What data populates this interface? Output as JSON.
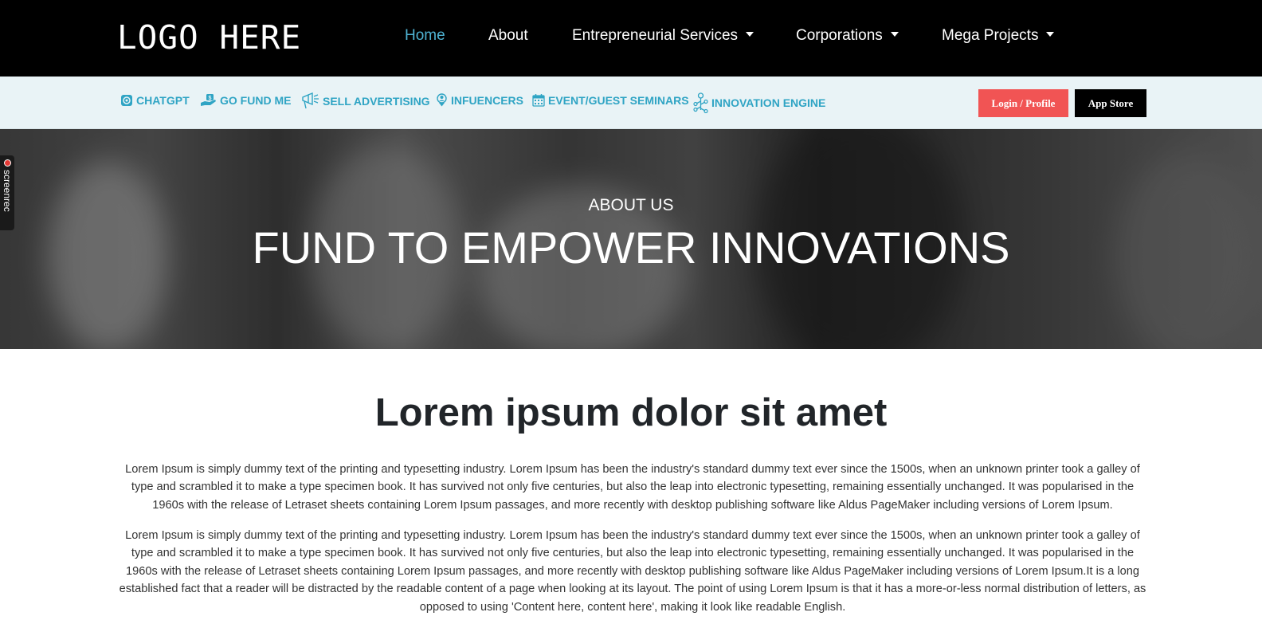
{
  "header": {
    "logo": "LOGO HERE",
    "nav": [
      {
        "label": "Home",
        "active": true
      },
      {
        "label": "About"
      },
      {
        "label": "Entrepreneurial Services"
      },
      {
        "label": "Corporations"
      },
      {
        "label": "Mega Projects"
      }
    ]
  },
  "subnav": {
    "items": [
      {
        "label": "CHATGPT",
        "icon": "chatgpt-icon"
      },
      {
        "label": "GO FUND ME",
        "icon": "money-hand-icon"
      },
      {
        "label": "SELL ADVERTISING",
        "icon": "advertising-icon"
      },
      {
        "label": "INFUENCERS",
        "icon": "influencer-icon"
      },
      {
        "label": "EVENT/GUEST SEMINARS",
        "icon": "calendar-icon"
      },
      {
        "label": "INNOVATION ENGINE",
        "icon": "innovation-icon"
      }
    ],
    "login_label": "Login / Profile",
    "app_store_label": "App Store"
  },
  "hero": {
    "eyebrow": "ABOUT US",
    "title": "FUND TO EMPOWER INNOVATIONS"
  },
  "screenrec": {
    "label": "screenrec"
  },
  "content": {
    "heading": "Lorem ipsum dolor sit amet",
    "paragraphs": [
      "Lorem Ipsum is simply dummy text of the printing and typesetting industry. Lorem Ipsum has been the industry's standard dummy text ever since the 1500s, when an unknown printer took a galley of type and scrambled it to make a type specimen book. It has survived not only five centuries, but also the leap into electronic typesetting, remaining essentially unchanged. It was popularised in the 1960s with the release of Letraset sheets containing Lorem Ipsum passages, and more recently with desktop publishing software like Aldus PageMaker including versions of Lorem Ipsum.",
      "Lorem Ipsum is simply dummy text of the printing and typesetting industry. Lorem Ipsum has been the industry's standard dummy text ever since the 1500s, when an unknown printer took a galley of type and scrambled it to make a type specimen book. It has survived not only five centuries, but also the leap into electronic typesetting, remaining essentially unchanged. It was popularised in the 1960s with the release of Letraset sheets containing Lorem Ipsum passages, and more recently with desktop publishing software like Aldus PageMaker including versions of Lorem Ipsum.It is a long established fact that a reader will be distracted by the readable content of a page when looking at its layout. The point of using Lorem Ipsum is that it has a more-or-less normal distribution of letters, as opposed to using 'Content here, content here', making it look like readable English."
    ]
  },
  "colors": {
    "nav_active": "#4fb3d3",
    "subnav_text": "#2fa4c4",
    "subnav_bg": "#e9f3f6",
    "login_bg": "#f15454",
    "app_store_bg": "#000000"
  }
}
